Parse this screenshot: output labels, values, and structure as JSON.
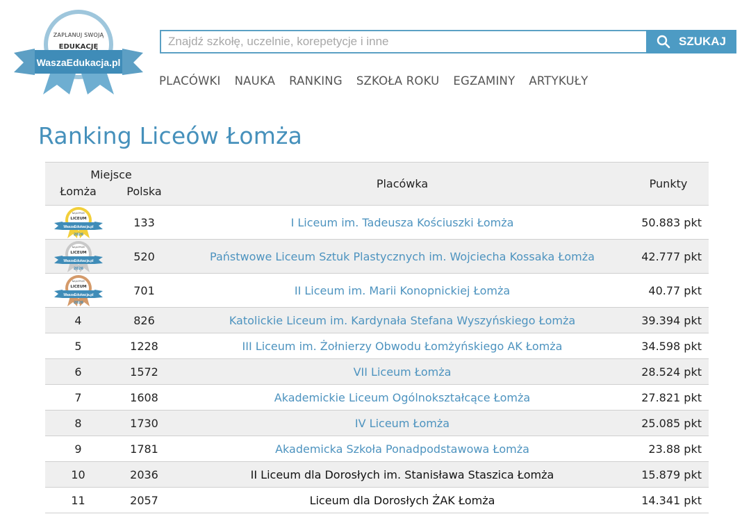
{
  "logo": {
    "line1": "ZAPLANUJ SWOJĄ",
    "line2": "EDUKACJĘ",
    "brand": "WaszaEdukacja.pl"
  },
  "search": {
    "placeholder": "Znajdź szkołę, uczelnie, korepetycje i inne",
    "button_label": "SZUKAJ"
  },
  "nav": [
    "PLACÓWKI",
    "NAUKA",
    "RANKING",
    "SZKOŁA ROKU",
    "EGZAMINY",
    "ARTYKUŁY"
  ],
  "page_title": "Ranking Liceów Łomża",
  "table": {
    "headers": {
      "miejsce": "Miejsce",
      "lomza": "Łomża",
      "polska": "Polska",
      "placowka": "Placówka",
      "punkty": "Punkty"
    },
    "medal_text": {
      "caption": "NAJLEPSZE",
      "type": "LICEUM",
      "brand": "WaszaEdukacja.pl",
      "year": "2026"
    },
    "medal_colors": {
      "gold": "#f2cf3a",
      "silver": "#c9c9c9",
      "bronze": "#d49a6a"
    },
    "rows": [
      {
        "lomza": "",
        "medal": "gold",
        "polska": "133",
        "name": "I Liceum im. Tadeusza Kościuszki Łomża",
        "points": "50.883 pkt",
        "link": true
      },
      {
        "lomza": "",
        "medal": "silver",
        "polska": "520",
        "name": "Państwowe Liceum Sztuk Plastycznych im. Wojciecha Kossaka Łomża",
        "points": "42.777 pkt",
        "link": true
      },
      {
        "lomza": "",
        "medal": "bronze",
        "polska": "701",
        "name": "II Liceum im. Marii Konopnickiej Łomża",
        "points": "40.77 pkt",
        "link": true
      },
      {
        "lomza": "4",
        "polska": "826",
        "name": "Katolickie Liceum im. Kardynała Stefana Wyszyńskiego Łomża",
        "points": "39.394 pkt",
        "link": true
      },
      {
        "lomza": "5",
        "polska": "1228",
        "name": "III Liceum im. Żołnierzy Obwodu Łomżyńskiego AK Łomża",
        "points": "34.598 pkt",
        "link": true
      },
      {
        "lomza": "6",
        "polska": "1572",
        "name": "VII Liceum Łomża",
        "points": "28.524 pkt",
        "link": true
      },
      {
        "lomza": "7",
        "polska": "1608",
        "name": "Akademickie Liceum Ogólnokształcące Łomża",
        "points": "27.821 pkt",
        "link": true
      },
      {
        "lomza": "8",
        "polska": "1730",
        "name": "IV Liceum Łomża",
        "points": "25.085 pkt",
        "link": true
      },
      {
        "lomza": "9",
        "polska": "1781",
        "name": "Akademicka Szkoła Ponadpodstawowa Łomża",
        "points": "23.88 pkt",
        "link": true
      },
      {
        "lomza": "10",
        "polska": "2036",
        "name": "II Liceum dla Dorosłych im. Stanisława Staszica Łomża",
        "points": "15.879 pkt",
        "link": false
      },
      {
        "lomza": "11",
        "polska": "2057",
        "name": "Liceum dla Dorosłych ŻAK Łomża",
        "points": "14.341 pkt",
        "link": false
      }
    ]
  }
}
